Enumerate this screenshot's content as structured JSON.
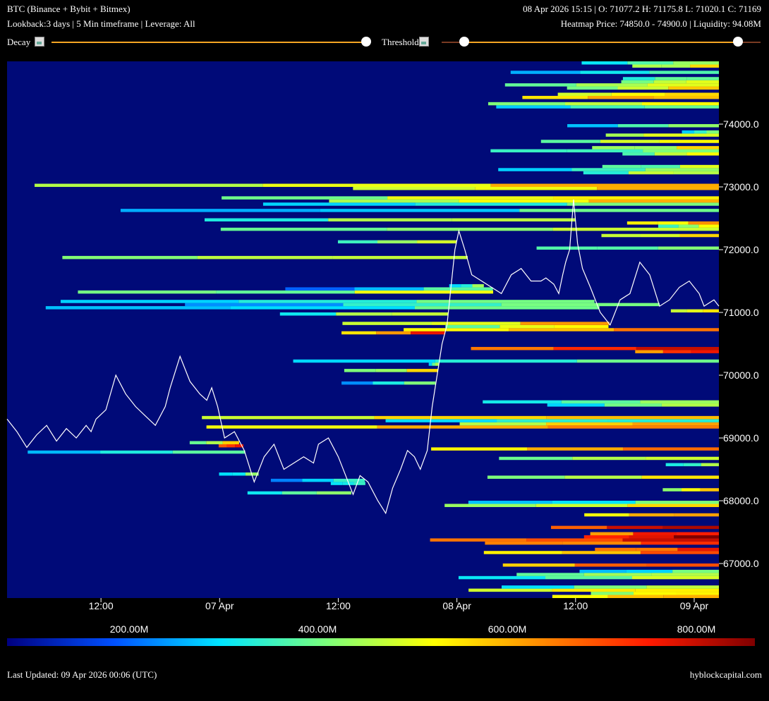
{
  "header": {
    "title": "BTC (Binance + Bybit + Bitmex)",
    "subtitle": "Lookback:3 days | 5 Min timeframe | Leverage: All",
    "ohlc": "08 Apr 2026 15:15 | O: 71077.2 H: 71175.8 L: 71020.1 C: 71169",
    "heatmap_info": "Heatmap Price: 74850.0 - 74900.0 | Liquidity: 94.08M"
  },
  "controls": {
    "decay_label": "Decay",
    "decay_value": 1.0,
    "threshold_label": "Threshold",
    "threshold_low": 0.07,
    "threshold_high": 0.93
  },
  "colors": {
    "accent": "#f5a623",
    "heatmap_bg": "#000a78",
    "price_line": "#ffffff"
  },
  "chart_data": {
    "type": "heatmap",
    "x_ticks": [
      "12:00",
      "07 Apr",
      "12:00",
      "08 Apr",
      "12:00",
      "09 Apr"
    ],
    "x_tick_hours": [
      12,
      24,
      36,
      48,
      60,
      72
    ],
    "x_range_hours": [
      2.5,
      74.5
    ],
    "y_ticks": [
      "74000.0",
      "73000.0",
      "72000.0",
      "71000.0",
      "70000.0",
      "69000.0",
      "68000.0",
      "67000.0"
    ],
    "y_tick_values": [
      74000,
      73000,
      72000,
      71000,
      70000,
      69000,
      68000,
      67000
    ],
    "ylim": [
      66450,
      75000
    ],
    "price_series": {
      "hours": [
        2.5,
        3.5,
        4.5,
        5.5,
        6.5,
        7.5,
        8.5,
        9.5,
        10.5,
        11.0,
        11.5,
        12.5,
        13.5,
        14.5,
        15.5,
        16.5,
        17.5,
        18.5,
        19.0,
        20.0,
        21.0,
        22.0,
        22.7,
        23.2,
        23.8,
        24.5,
        25.5,
        26.5,
        27.5,
        28.5,
        29.5,
        30.5,
        31.5,
        32.5,
        33.5,
        34.0,
        35.0,
        36.0,
        37.0,
        37.5,
        38.2,
        39.0,
        40.0,
        40.8,
        41.5,
        42.3,
        43.0,
        43.7,
        44.3,
        45.0,
        45.5,
        46.0,
        46.5,
        47.0,
        47.4,
        47.8,
        48.2,
        48.8,
        49.5,
        50.5,
        51.5,
        52.5,
        53.5,
        54.5,
        55.5,
        56.5,
        57.0,
        57.8,
        58.3,
        58.7,
        59.0,
        59.4,
        59.8,
        60.2,
        60.7,
        61.5,
        62.5,
        63.5,
        64.5,
        65.5,
        66.5,
        67.5,
        68.5,
        69.5,
        70.5,
        71.5,
        72.5,
        73.0,
        74.0,
        74.5
      ],
      "prices": [
        69300,
        69100,
        68850,
        69050,
        69200,
        68950,
        69150,
        69000,
        69200,
        69100,
        69300,
        69450,
        70000,
        69700,
        69500,
        69350,
        69200,
        69500,
        69800,
        70300,
        69900,
        69700,
        69600,
        69800,
        69500,
        69000,
        69100,
        68800,
        68300,
        68700,
        68900,
        68500,
        68600,
        68700,
        68600,
        68900,
        69000,
        68700,
        68300,
        68100,
        68400,
        68300,
        68000,
        67800,
        68200,
        68500,
        68800,
        68700,
        68500,
        68800,
        69500,
        70000,
        70500,
        70800,
        71400,
        72000,
        72300,
        72000,
        71600,
        71500,
        71400,
        71300,
        71600,
        71700,
        71500,
        71500,
        71550,
        71450,
        71300,
        71600,
        71800,
        72000,
        72800,
        72100,
        71700,
        71400,
        71000,
        70800,
        71200,
        71300,
        71800,
        71600,
        71100,
        71200,
        71400,
        71500,
        71300,
        71100,
        71200,
        71100
      ]
    },
    "legend": {
      "ticks": [
        "200.00M",
        "400.00M",
        "600.00M",
        "800.00M"
      ],
      "colors": [
        "#000080",
        "#0050ff",
        "#00e5ff",
        "#7dff7a",
        "#ffff00",
        "#ff8a00",
        "#ff1a00",
        "#800000"
      ]
    }
  },
  "footer": {
    "last_updated": "Last Updated: 09 Apr 2026 00:06 (UTC)",
    "brand": "hyblockcapital.com"
  }
}
